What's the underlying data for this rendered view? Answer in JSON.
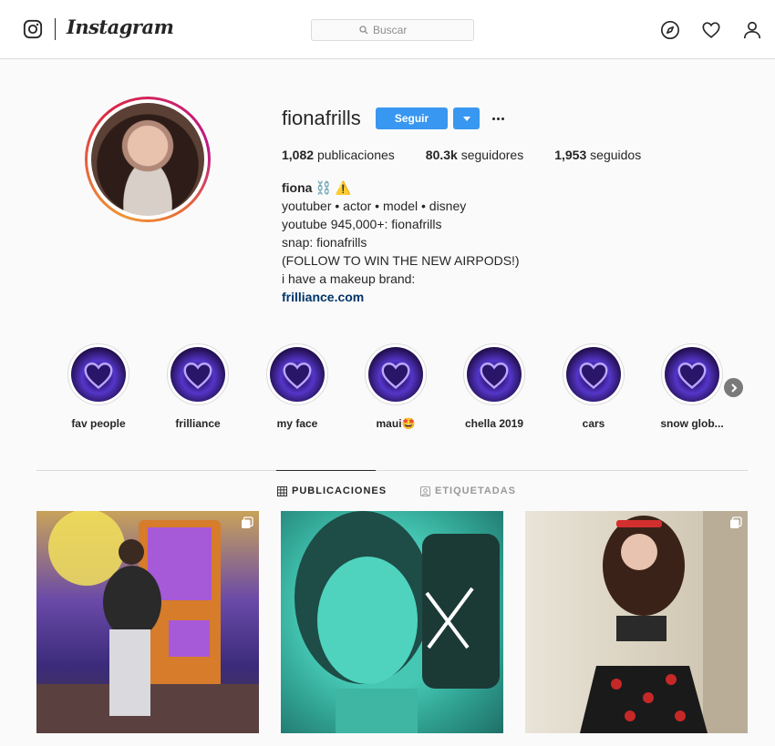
{
  "nav": {
    "brand": "Instagram",
    "search_placeholder": "Buscar"
  },
  "profile": {
    "username": "fionafrills",
    "follow_label": "Seguir",
    "stats": [
      {
        "count": "1,082",
        "label": "publicaciones"
      },
      {
        "count": "80.3k",
        "label": "seguidores"
      },
      {
        "count": "1,953",
        "label": "seguidos"
      }
    ],
    "full_name": "fiona ⛓️ ⚠️",
    "bio_lines": [
      "youtuber • actor • model • disney",
      "youtube 945,000+: fionafrills",
      "snap: fionafrills",
      "(FOLLOW TO WIN THE NEW AIRPODS!)",
      "i have a makeup brand:"
    ],
    "bio_link": "frilliance.com"
  },
  "highlights": [
    {
      "label": "fav people"
    },
    {
      "label": "frilliance"
    },
    {
      "label": "my face"
    },
    {
      "label": "maui🤩"
    },
    {
      "label": "chella 2019"
    },
    {
      "label": "cars"
    },
    {
      "label": "snow glob..."
    }
  ],
  "tabs": [
    {
      "label": "PUBLICACIONES",
      "active": true
    },
    {
      "label": "ETIQUETADAS",
      "active": false
    }
  ],
  "colors": {
    "accent": "#3897f0",
    "link": "#003569",
    "border": "#dbdbdb"
  }
}
